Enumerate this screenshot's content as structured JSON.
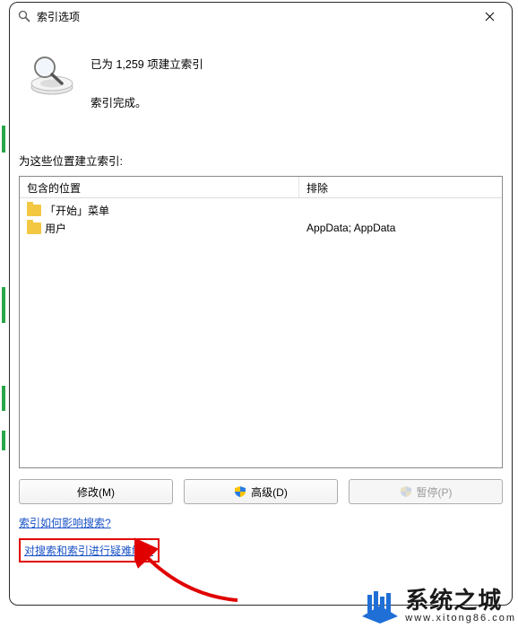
{
  "title": "索引选项",
  "status": {
    "line1": "已为 1,259 项建立索引",
    "line2": "索引完成。"
  },
  "section_label": "为这些位置建立索引:",
  "table": {
    "headers": {
      "include": "包含的位置",
      "exclude": "排除"
    },
    "rows": [
      {
        "include": "「开始」菜单",
        "exclude": ""
      },
      {
        "include": "用户",
        "exclude": "AppData; AppData"
      }
    ]
  },
  "buttons": {
    "modify": "修改(M)",
    "advanced": "高级(D)",
    "pause": "暂停(P)"
  },
  "links": {
    "how_affect": "索引如何影响搜索?",
    "troubleshoot": "对搜索和索引进行疑难解答"
  },
  "watermark": {
    "title": "系统之城",
    "url": "www.xitong86.com"
  }
}
